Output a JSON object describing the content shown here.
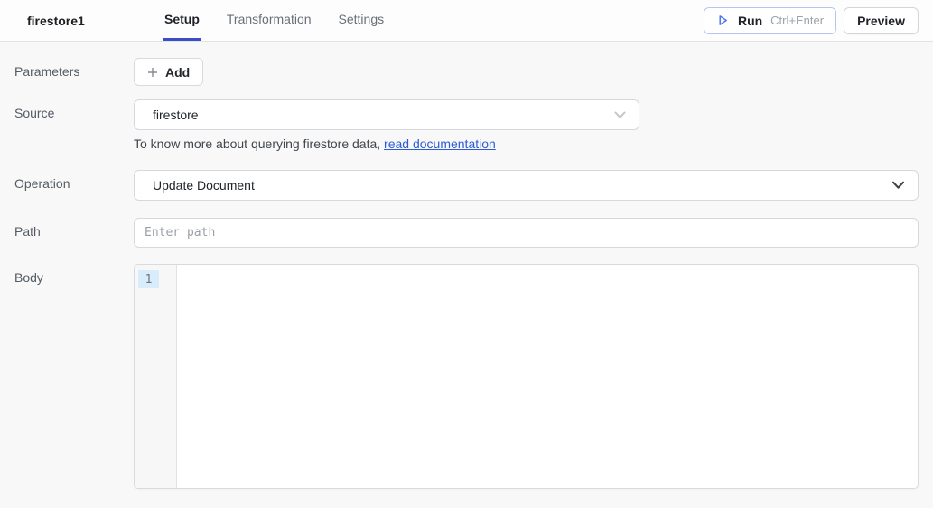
{
  "header": {
    "title": "firestore1",
    "tabs": [
      {
        "label": "Setup",
        "active": true
      },
      {
        "label": "Transformation",
        "active": false
      },
      {
        "label": "Settings",
        "active": false
      }
    ],
    "run_button": {
      "label": "Run",
      "shortcut": "Ctrl+Enter",
      "icon": "play-icon"
    },
    "preview_button": {
      "label": "Preview"
    }
  },
  "form": {
    "parameters": {
      "label": "Parameters",
      "add_button_label": "Add",
      "add_icon": "plus-icon"
    },
    "source": {
      "label": "Source",
      "selected_value": "firestore",
      "helper_text": "To know more about querying firestore data, ",
      "helper_link": "read documentation",
      "chevron": "chevron-down-icon"
    },
    "operation": {
      "label": "Operation",
      "selected_value": "Update Document",
      "chevron": "chevron-down-icon"
    },
    "path": {
      "label": "Path",
      "placeholder": "Enter path",
      "value": ""
    },
    "body": {
      "label": "Body",
      "line_numbers": [
        "1"
      ],
      "content": ""
    }
  },
  "colors": {
    "accent": "#3b4ec9",
    "link": "#2d5bd7",
    "run-border": "#b6c4f3",
    "run-icon": "#4c74ee",
    "active-line": "#d9ecfb"
  }
}
